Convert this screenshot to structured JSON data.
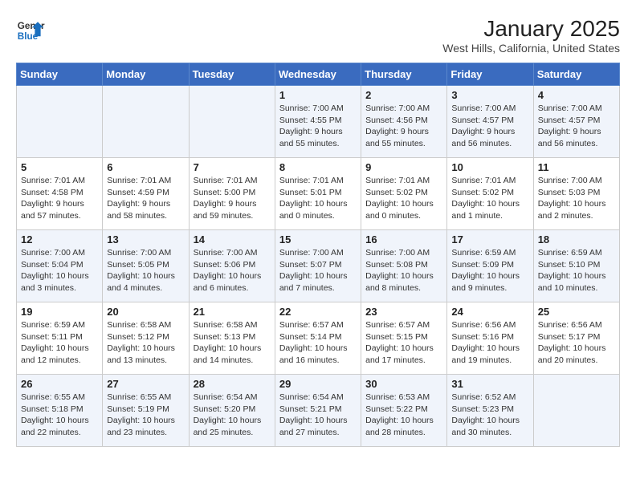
{
  "header": {
    "logo_line1": "General",
    "logo_line2": "Blue",
    "title": "January 2025",
    "subtitle": "West Hills, California, United States"
  },
  "weekdays": [
    "Sunday",
    "Monday",
    "Tuesday",
    "Wednesday",
    "Thursday",
    "Friday",
    "Saturday"
  ],
  "weeks": [
    [
      {
        "day": "",
        "info": ""
      },
      {
        "day": "",
        "info": ""
      },
      {
        "day": "",
        "info": ""
      },
      {
        "day": "1",
        "info": "Sunrise: 7:00 AM\nSunset: 4:55 PM\nDaylight: 9 hours\nand 55 minutes."
      },
      {
        "day": "2",
        "info": "Sunrise: 7:00 AM\nSunset: 4:56 PM\nDaylight: 9 hours\nand 55 minutes."
      },
      {
        "day": "3",
        "info": "Sunrise: 7:00 AM\nSunset: 4:57 PM\nDaylight: 9 hours\nand 56 minutes."
      },
      {
        "day": "4",
        "info": "Sunrise: 7:00 AM\nSunset: 4:57 PM\nDaylight: 9 hours\nand 56 minutes."
      }
    ],
    [
      {
        "day": "5",
        "info": "Sunrise: 7:01 AM\nSunset: 4:58 PM\nDaylight: 9 hours\nand 57 minutes."
      },
      {
        "day": "6",
        "info": "Sunrise: 7:01 AM\nSunset: 4:59 PM\nDaylight: 9 hours\nand 58 minutes."
      },
      {
        "day": "7",
        "info": "Sunrise: 7:01 AM\nSunset: 5:00 PM\nDaylight: 9 hours\nand 59 minutes."
      },
      {
        "day": "8",
        "info": "Sunrise: 7:01 AM\nSunset: 5:01 PM\nDaylight: 10 hours\nand 0 minutes."
      },
      {
        "day": "9",
        "info": "Sunrise: 7:01 AM\nSunset: 5:02 PM\nDaylight: 10 hours\nand 0 minutes."
      },
      {
        "day": "10",
        "info": "Sunrise: 7:01 AM\nSunset: 5:02 PM\nDaylight: 10 hours\nand 1 minute."
      },
      {
        "day": "11",
        "info": "Sunrise: 7:00 AM\nSunset: 5:03 PM\nDaylight: 10 hours\nand 2 minutes."
      }
    ],
    [
      {
        "day": "12",
        "info": "Sunrise: 7:00 AM\nSunset: 5:04 PM\nDaylight: 10 hours\nand 3 minutes."
      },
      {
        "day": "13",
        "info": "Sunrise: 7:00 AM\nSunset: 5:05 PM\nDaylight: 10 hours\nand 4 minutes."
      },
      {
        "day": "14",
        "info": "Sunrise: 7:00 AM\nSunset: 5:06 PM\nDaylight: 10 hours\nand 6 minutes."
      },
      {
        "day": "15",
        "info": "Sunrise: 7:00 AM\nSunset: 5:07 PM\nDaylight: 10 hours\nand 7 minutes."
      },
      {
        "day": "16",
        "info": "Sunrise: 7:00 AM\nSunset: 5:08 PM\nDaylight: 10 hours\nand 8 minutes."
      },
      {
        "day": "17",
        "info": "Sunrise: 6:59 AM\nSunset: 5:09 PM\nDaylight: 10 hours\nand 9 minutes."
      },
      {
        "day": "18",
        "info": "Sunrise: 6:59 AM\nSunset: 5:10 PM\nDaylight: 10 hours\nand 10 minutes."
      }
    ],
    [
      {
        "day": "19",
        "info": "Sunrise: 6:59 AM\nSunset: 5:11 PM\nDaylight: 10 hours\nand 12 minutes."
      },
      {
        "day": "20",
        "info": "Sunrise: 6:58 AM\nSunset: 5:12 PM\nDaylight: 10 hours\nand 13 minutes."
      },
      {
        "day": "21",
        "info": "Sunrise: 6:58 AM\nSunset: 5:13 PM\nDaylight: 10 hours\nand 14 minutes."
      },
      {
        "day": "22",
        "info": "Sunrise: 6:57 AM\nSunset: 5:14 PM\nDaylight: 10 hours\nand 16 minutes."
      },
      {
        "day": "23",
        "info": "Sunrise: 6:57 AM\nSunset: 5:15 PM\nDaylight: 10 hours\nand 17 minutes."
      },
      {
        "day": "24",
        "info": "Sunrise: 6:56 AM\nSunset: 5:16 PM\nDaylight: 10 hours\nand 19 minutes."
      },
      {
        "day": "25",
        "info": "Sunrise: 6:56 AM\nSunset: 5:17 PM\nDaylight: 10 hours\nand 20 minutes."
      }
    ],
    [
      {
        "day": "26",
        "info": "Sunrise: 6:55 AM\nSunset: 5:18 PM\nDaylight: 10 hours\nand 22 minutes."
      },
      {
        "day": "27",
        "info": "Sunrise: 6:55 AM\nSunset: 5:19 PM\nDaylight: 10 hours\nand 23 minutes."
      },
      {
        "day": "28",
        "info": "Sunrise: 6:54 AM\nSunset: 5:20 PM\nDaylight: 10 hours\nand 25 minutes."
      },
      {
        "day": "29",
        "info": "Sunrise: 6:54 AM\nSunset: 5:21 PM\nDaylight: 10 hours\nand 27 minutes."
      },
      {
        "day": "30",
        "info": "Sunrise: 6:53 AM\nSunset: 5:22 PM\nDaylight: 10 hours\nand 28 minutes."
      },
      {
        "day": "31",
        "info": "Sunrise: 6:52 AM\nSunset: 5:23 PM\nDaylight: 10 hours\nand 30 minutes."
      },
      {
        "day": "",
        "info": ""
      }
    ]
  ],
  "alt_rows": [
    0,
    2,
    4
  ],
  "colors": {
    "header_bg": "#3a6bbf",
    "alt_row_bg": "#f0f4fb",
    "normal_row_bg": "#ffffff"
  }
}
